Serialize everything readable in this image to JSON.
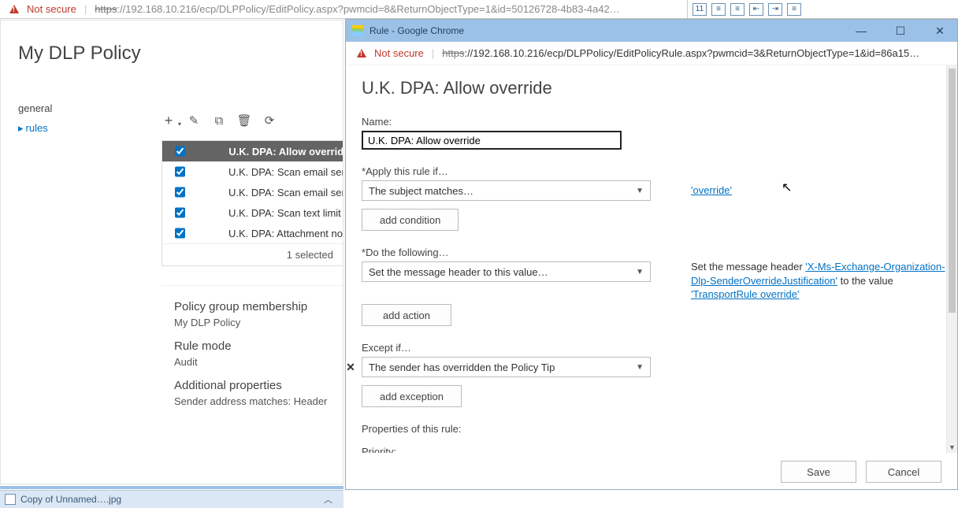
{
  "parent": {
    "not_secure": "Not secure",
    "url_scheme": "https",
    "url_rest": "://192.168.10.216/ecp/DLPPolicy/EditPolicy.aspx?pwmcid=8&ReturnObjectType=1&id=50126728-4b83-4a42…",
    "title": "My DLP Policy",
    "tabs": {
      "general": "general",
      "rules": "rules"
    },
    "rules": [
      {
        "label": "U.K. DPA: Allow override",
        "checked": true,
        "selected": true
      },
      {
        "label": "U.K. DPA: Scan email sent o",
        "checked": true,
        "selected": false
      },
      {
        "label": "U.K. DPA: Scan email sent o",
        "checked": true,
        "selected": false
      },
      {
        "label": "U.K. DPA: Scan text limit ex",
        "checked": true,
        "selected": false
      },
      {
        "label": "U.K. DPA: Attachment not s",
        "checked": true,
        "selected": false
      }
    ],
    "selected_count": "1 selected",
    "details": {
      "group_label": "Policy group membership",
      "group_value": "My DLP Policy",
      "mode_label": "Rule mode",
      "mode_value": "Audit",
      "props_label": "Additional properties",
      "props_value": "Sender address matches: Header"
    },
    "taskbar_file": "Copy of Unnamed….jpg"
  },
  "child": {
    "window_title": "Rule - Google Chrome",
    "not_secure": "Not secure",
    "url_scheme": "https",
    "url_rest": "://192.168.10.216/ecp/DLPPolicy/EditPolicyRule.aspx?pwmcid=3&ReturnObjectType=1&id=86a15…",
    "heading": "U.K. DPA: Allow override",
    "name_label": "Name:",
    "name_value": "U.K. DPA: Allow override",
    "apply_label": "Apply this rule if…",
    "apply_dd": "The subject matches…",
    "apply_side": "'override'",
    "add_condition": "add condition",
    "do_label": "Do the following…",
    "do_dd": "Set the message header to this value…",
    "do_side_pre": "Set the message header ",
    "do_side_link1": "'X-Ms-Exchange-Organization-Dlp-SenderOverrideJustification'",
    "do_side_mid": " to the value ",
    "do_side_link2": "'TransportRule override'",
    "add_action": "add action",
    "except_label": "Except if…",
    "except_dd": "The sender has overridden the Policy Tip",
    "add_exception": "add exception",
    "props_label": "Properties of this rule:",
    "priority_label": "Priority:",
    "save": "Save",
    "cancel": "Cancel"
  }
}
